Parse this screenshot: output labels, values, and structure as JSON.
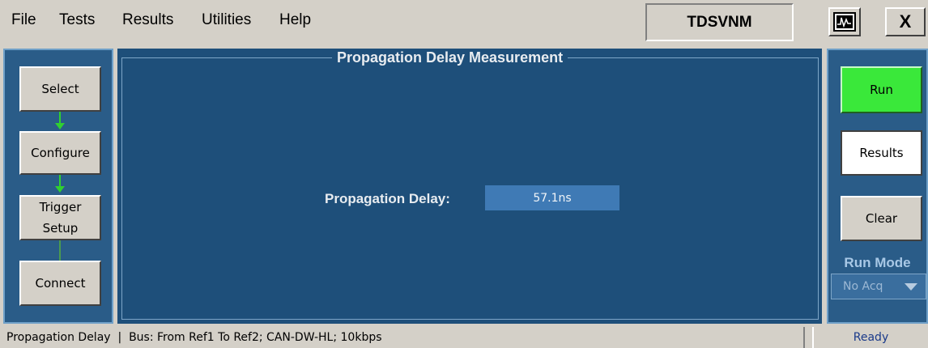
{
  "menu": {
    "file": "File",
    "tests": "Tests",
    "results": "Results",
    "utilities": "Utilities",
    "help": "Help"
  },
  "app_name": "TDSVNM",
  "close_label": "X",
  "left_nav": {
    "select": "Select",
    "configure": "Configure",
    "trigger_line1": "Trigger",
    "trigger_line2": "Setup",
    "connect": "Connect"
  },
  "main": {
    "group_title": "Propagation Delay Measurement",
    "delay_label": "Propagation Delay:",
    "delay_value": "57.1ns"
  },
  "right_controls": {
    "run": "Run",
    "results": "Results",
    "clear": "Clear",
    "run_mode_label": "Run Mode",
    "run_mode_value": "No Acq"
  },
  "status": {
    "text": "Propagation Delay  |  Bus: From Ref1 To Ref2; CAN-DW-HL; 10kbps",
    "state": "Ready"
  },
  "colors": {
    "run_button": "#3ae83a",
    "panel_blue": "#1e4f7a",
    "flow_green": "#30d030"
  },
  "icons": {
    "scope": "waveform-icon",
    "close": "close-icon"
  }
}
